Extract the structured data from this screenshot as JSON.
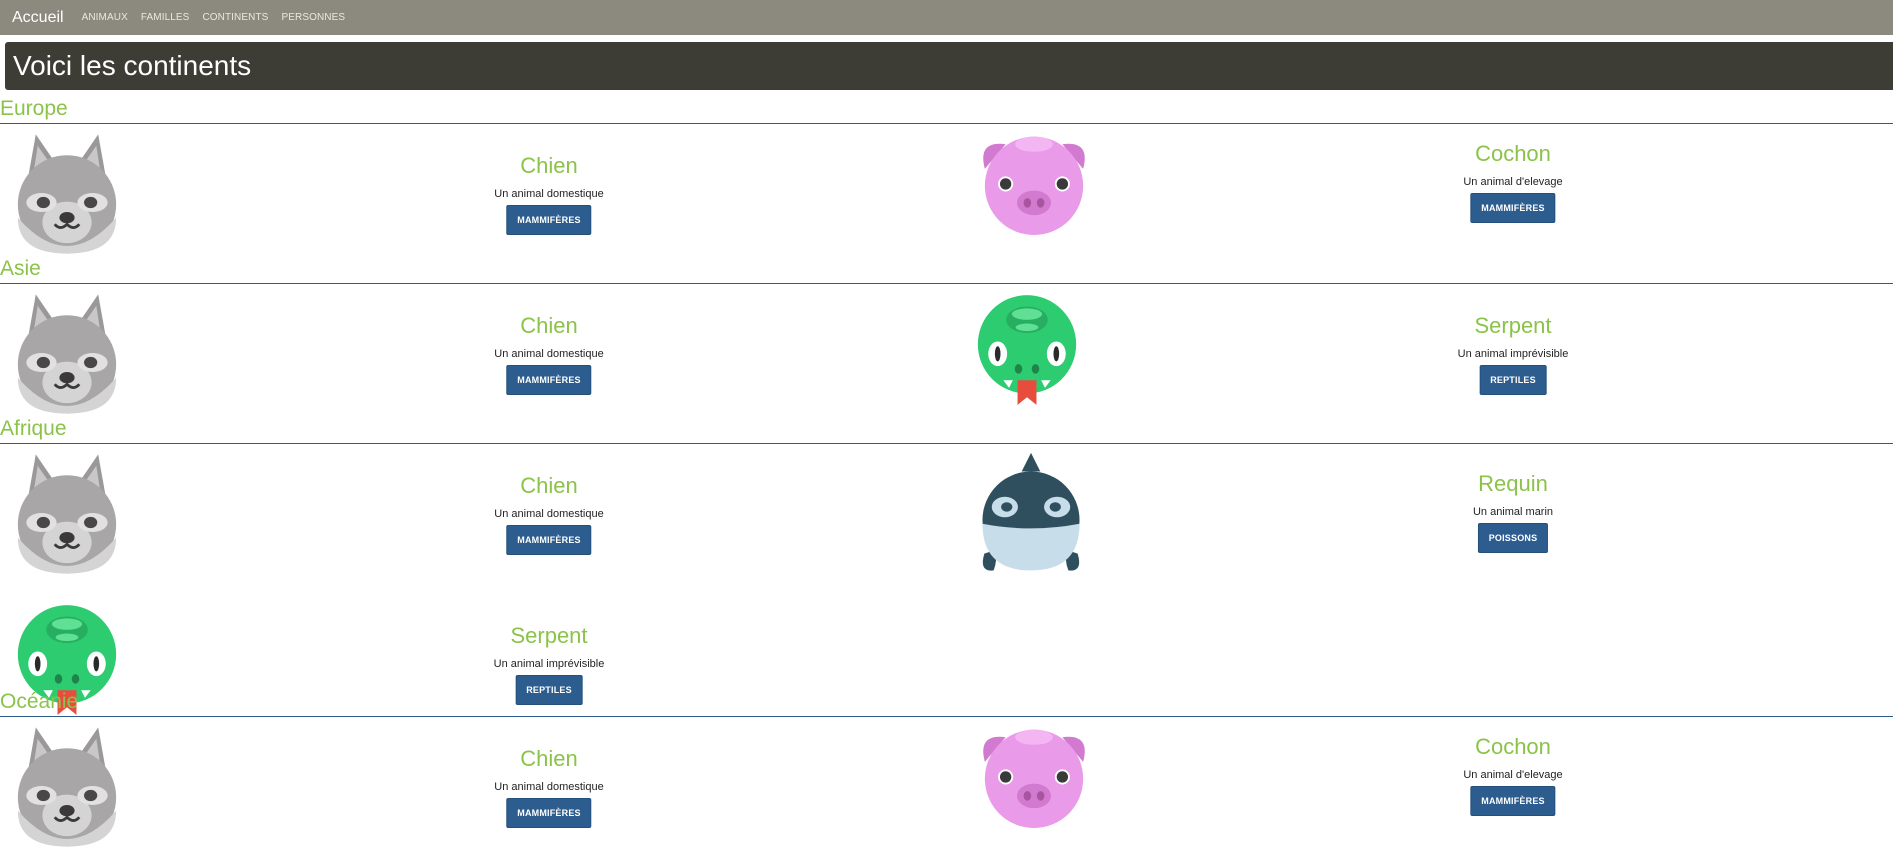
{
  "navbar": {
    "brand": "Accueil",
    "links": [
      "ANIMAUX",
      "FAMILLES",
      "CONTINENTS",
      "PERSONNES"
    ]
  },
  "page_title": "Voici les continents",
  "continents": [
    {
      "name": "Europe",
      "animals": [
        {
          "name": "Chien",
          "desc": "Un animal domestique",
          "family": "MAMMIFÈRES",
          "icon": "dog-icon"
        },
        {
          "name": "Cochon",
          "desc": "Un animal d'elevage",
          "family": "MAMMIFÈRES",
          "icon": "pig-icon"
        }
      ]
    },
    {
      "name": "Asie",
      "animals": [
        {
          "name": "Chien",
          "desc": "Un animal domestique",
          "family": "MAMMIFÈRES",
          "icon": "dog-icon"
        },
        {
          "name": "Serpent",
          "desc": "Un animal imprévisible",
          "family": "REPTILES",
          "icon": "snake-icon"
        }
      ]
    },
    {
      "name": "Afrique",
      "animals": [
        {
          "name": "Chien",
          "desc": "Un animal domestique",
          "family": "MAMMIFÈRES",
          "icon": "dog-icon"
        },
        {
          "name": "Requin",
          "desc": "Un animal marin",
          "family": "POISSONS",
          "icon": "shark-icon"
        },
        {
          "name": "Serpent",
          "desc": "Un animal imprévisible",
          "family": "REPTILES",
          "icon": "snake-icon"
        }
      ]
    },
    {
      "name": "Océanie",
      "animals": [
        {
          "name": "Chien",
          "desc": "Un animal domestique",
          "family": "MAMMIFÈRES",
          "icon": "dog-icon"
        },
        {
          "name": "Cochon",
          "desc": "Un animal d'elevage",
          "family": "MAMMIFÈRES",
          "icon": "pig-icon"
        }
      ]
    }
  ],
  "colors": {
    "navbar": "#8c897e",
    "title_bg": "#3d3d36",
    "accent_green": "#8bc34a",
    "button_blue": "#2d5d8f",
    "divider": "#2f5b8c"
  }
}
